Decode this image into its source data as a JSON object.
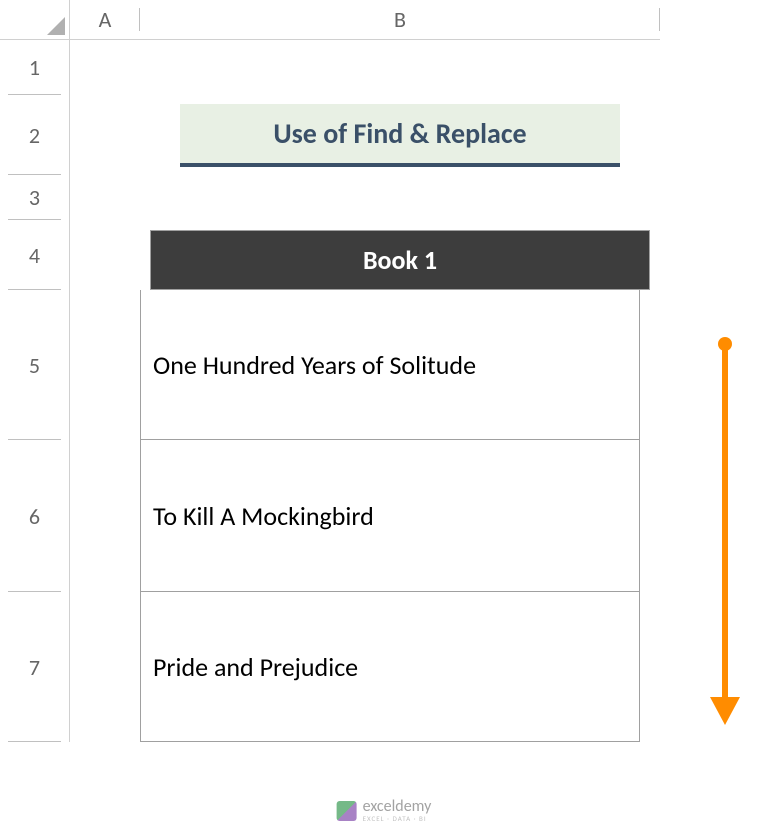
{
  "columns": {
    "a": "A",
    "b": "B"
  },
  "rows": {
    "r1": "1",
    "r2": "2",
    "r3": "3",
    "r4": "4",
    "r5": "5",
    "r6": "6",
    "r7": "7"
  },
  "title": "Use of Find & Replace",
  "table": {
    "header": "Book 1",
    "rows": [
      "One Hundred Years of Solitude",
      "To Kill A Mockingbird",
      "Pride and Prejudice"
    ]
  },
  "watermark": {
    "main": "exceldemy",
    "sub": "EXCEL · DATA · BI"
  }
}
